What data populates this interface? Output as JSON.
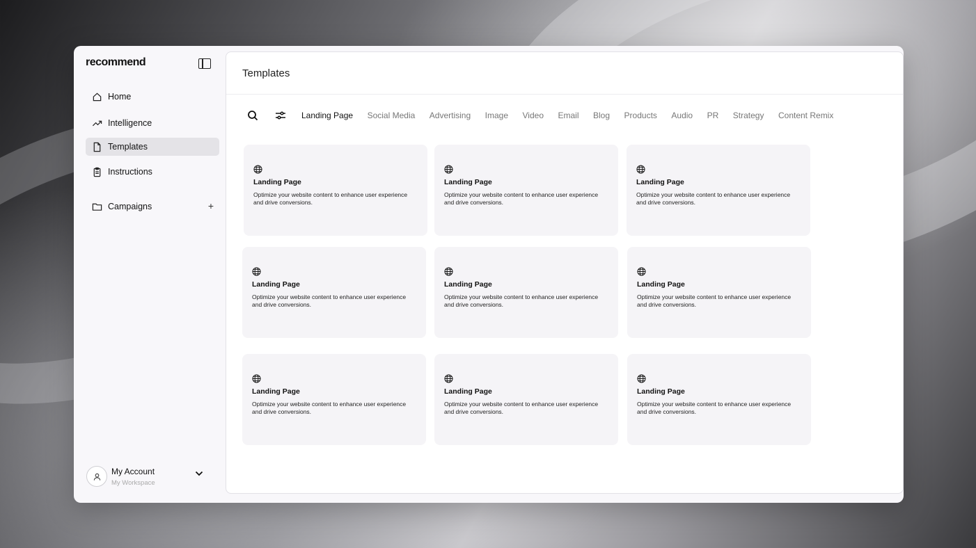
{
  "app": {
    "brand": "recommend"
  },
  "sidebar": {
    "items": [
      {
        "label": "Home",
        "icon": "home-icon"
      },
      {
        "label": "Intelligence",
        "icon": "trend-icon"
      },
      {
        "label": "Templates",
        "icon": "document-icon",
        "active": true
      },
      {
        "label": "Instructions",
        "icon": "clipboard-icon"
      },
      {
        "label": "Campaigns",
        "icon": "folder-icon"
      }
    ],
    "account": {
      "name": "My Account",
      "workspace": "My Workspace"
    }
  },
  "main": {
    "title": "Templates",
    "tabs": [
      {
        "label": "Landing Page",
        "active": true
      },
      {
        "label": "Social Media"
      },
      {
        "label": "Advertising"
      },
      {
        "label": "Image"
      },
      {
        "label": "Video"
      },
      {
        "label": "Email"
      },
      {
        "label": "Blog"
      },
      {
        "label": "Products"
      },
      {
        "label": "Audio"
      },
      {
        "label": "PR"
      },
      {
        "label": "Strategy"
      },
      {
        "label": "Content Remix"
      }
    ],
    "cards": [
      {
        "title": "Landing Page",
        "desc": "Optimize your website content to enhance user experience and drive conversions.",
        "icon": "globe-icon"
      },
      {
        "title": "Landing Page",
        "desc": "Optimize your website content to enhance user experience and drive conversions.",
        "icon": "globe-icon"
      },
      {
        "title": "Landing Page",
        "desc": "Optimize your website content to enhance user experience and drive conversions.",
        "icon": "globe-icon"
      },
      {
        "title": "Landing Page",
        "desc": "Optimize your website content to enhance user experience and drive conversions.",
        "icon": "globe-icon"
      },
      {
        "title": "Landing Page",
        "desc": "Optimize your website content to enhance user experience and drive conversions.",
        "icon": "globe-icon"
      },
      {
        "title": "Landing Page",
        "desc": "Optimize your website content to enhance user experience and drive conversions.",
        "icon": "globe-icon"
      },
      {
        "title": "Landing Page",
        "desc": "Optimize your website content to enhance user experience and drive conversions.",
        "icon": "globe-icon"
      },
      {
        "title": "Landing Page",
        "desc": "Optimize your website content to enhance user experience and drive conversions.",
        "icon": "globe-icon"
      },
      {
        "title": "Landing Page",
        "desc": "Optimize your website content to enhance user experience and drive conversions.",
        "icon": "globe-icon"
      }
    ]
  }
}
